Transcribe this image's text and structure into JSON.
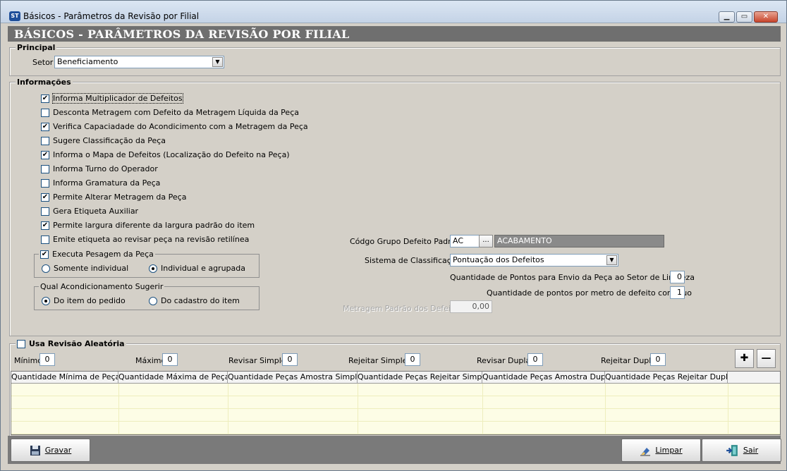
{
  "window": {
    "title": "Básicos - Parâmetros da Revisão por Filial",
    "app_icon_text": "ST",
    "controls": [
      "minimize",
      "maximize",
      "close"
    ]
  },
  "header": {
    "title": "BÁSICOS - PARÂMETROS DA REVISÃO  POR FILIAL"
  },
  "principal": {
    "group_label": "Principal",
    "setor_label": "Setor",
    "setor_value": "Beneficiamento"
  },
  "informacoes": {
    "group_label": "Informações",
    "checkboxes": [
      {
        "label": "Informa Multiplicador de Defeitos",
        "checked": true
      },
      {
        "label": "Desconta Metragem com Defeito da Metragem Líquida da Peça",
        "checked": false
      },
      {
        "label": "Verifica Capaciadade do Acondicimento com a Metragem da Peça",
        "checked": true
      },
      {
        "label": "Sugere Classificação da Peça",
        "checked": false
      },
      {
        "label": "Informa o Mapa de Defeitos (Localização do Defeito na Peça)",
        "checked": true
      },
      {
        "label": "Informa Turno do Operador",
        "checked": false
      },
      {
        "label": "Informa Gramatura da Peça",
        "checked": false
      },
      {
        "label": "Permite Alterar Metragem da Peça",
        "checked": true
      },
      {
        "label": "Gera Etiqueta Auxiliar",
        "checked": false
      },
      {
        "label": "Permite largura diferente da largura padrão do item",
        "checked": true
      },
      {
        "label": "Emite etiqueta ao revisar peça na revisão retilínea",
        "checked": false
      }
    ],
    "pesagem": {
      "label": "Executa Pesagem da Peça",
      "checked": true,
      "options": [
        "Somente individual",
        "Individual e agrupada"
      ],
      "selected": 1
    },
    "acondicionamento": {
      "label": "Qual Acondicionamento Sugerir",
      "options": [
        "Do item do pedido",
        "Do cadastro do item"
      ],
      "selected": 0
    },
    "codigo_grupo_label": "Códgo Grupo Defeito Padrão",
    "codigo_grupo_value": "AC",
    "codigo_grupo_lookup": "...",
    "codigo_grupo_desc": "ACABAMENTO",
    "sistema_label": "Sistema de Classificação",
    "sistema_value": "Pontuação dos Defeitos",
    "qtd_pontos_envio_label": "Quantidade de Pontos para Envio da  Peça ao Setor de Limpeza",
    "qtd_pontos_envio_value": "0",
    "qtd_pontos_metro_label": "Quantidade de pontos por metro de defeito continuo",
    "qtd_pontos_metro_value": "1",
    "metragem_padrao_label": "Metragem Padrão dos Defeitos",
    "metragem_padrao_value": "0,00"
  },
  "revisao": {
    "label": "Usa Revisão Aleatória",
    "checked": false,
    "minimo_label": "Mínimo",
    "minimo_value": "0",
    "maximo_label": "Máximo",
    "maximo_value": "0",
    "revisar_simples_label": "Revisar Simples",
    "revisar_simples_value": "0",
    "rejeitar_simples_label": "Rejeitar Simples",
    "rejeitar_simples_value": "0",
    "revisar_dupla_label": "Revisar Dupla",
    "revisar_dupla_value": "0",
    "rejeitar_dupla_label": "Rejeitar Dupla",
    "rejeitar_dupla_value": "0",
    "add_symbol": "✚",
    "remove_symbol": "—",
    "columns": [
      "Quantidade Mínima de Peças",
      "Quantidade Máxima de Peças",
      "Quantidade Peças Amostra Simples",
      "Quantidade Peças Rejeitar Simple",
      "Quantidade Peças Amostra Dupla",
      "Quantidade Peças Rejeitar Dupla"
    ]
  },
  "buttons": {
    "gravar": "Gravar",
    "limpar": "Limpar",
    "sair": "Sair"
  },
  "colors": {
    "header_band": "#6f6f6f",
    "grid_bg": "#fdfde6",
    "form_bg": "#d4d0c8"
  }
}
